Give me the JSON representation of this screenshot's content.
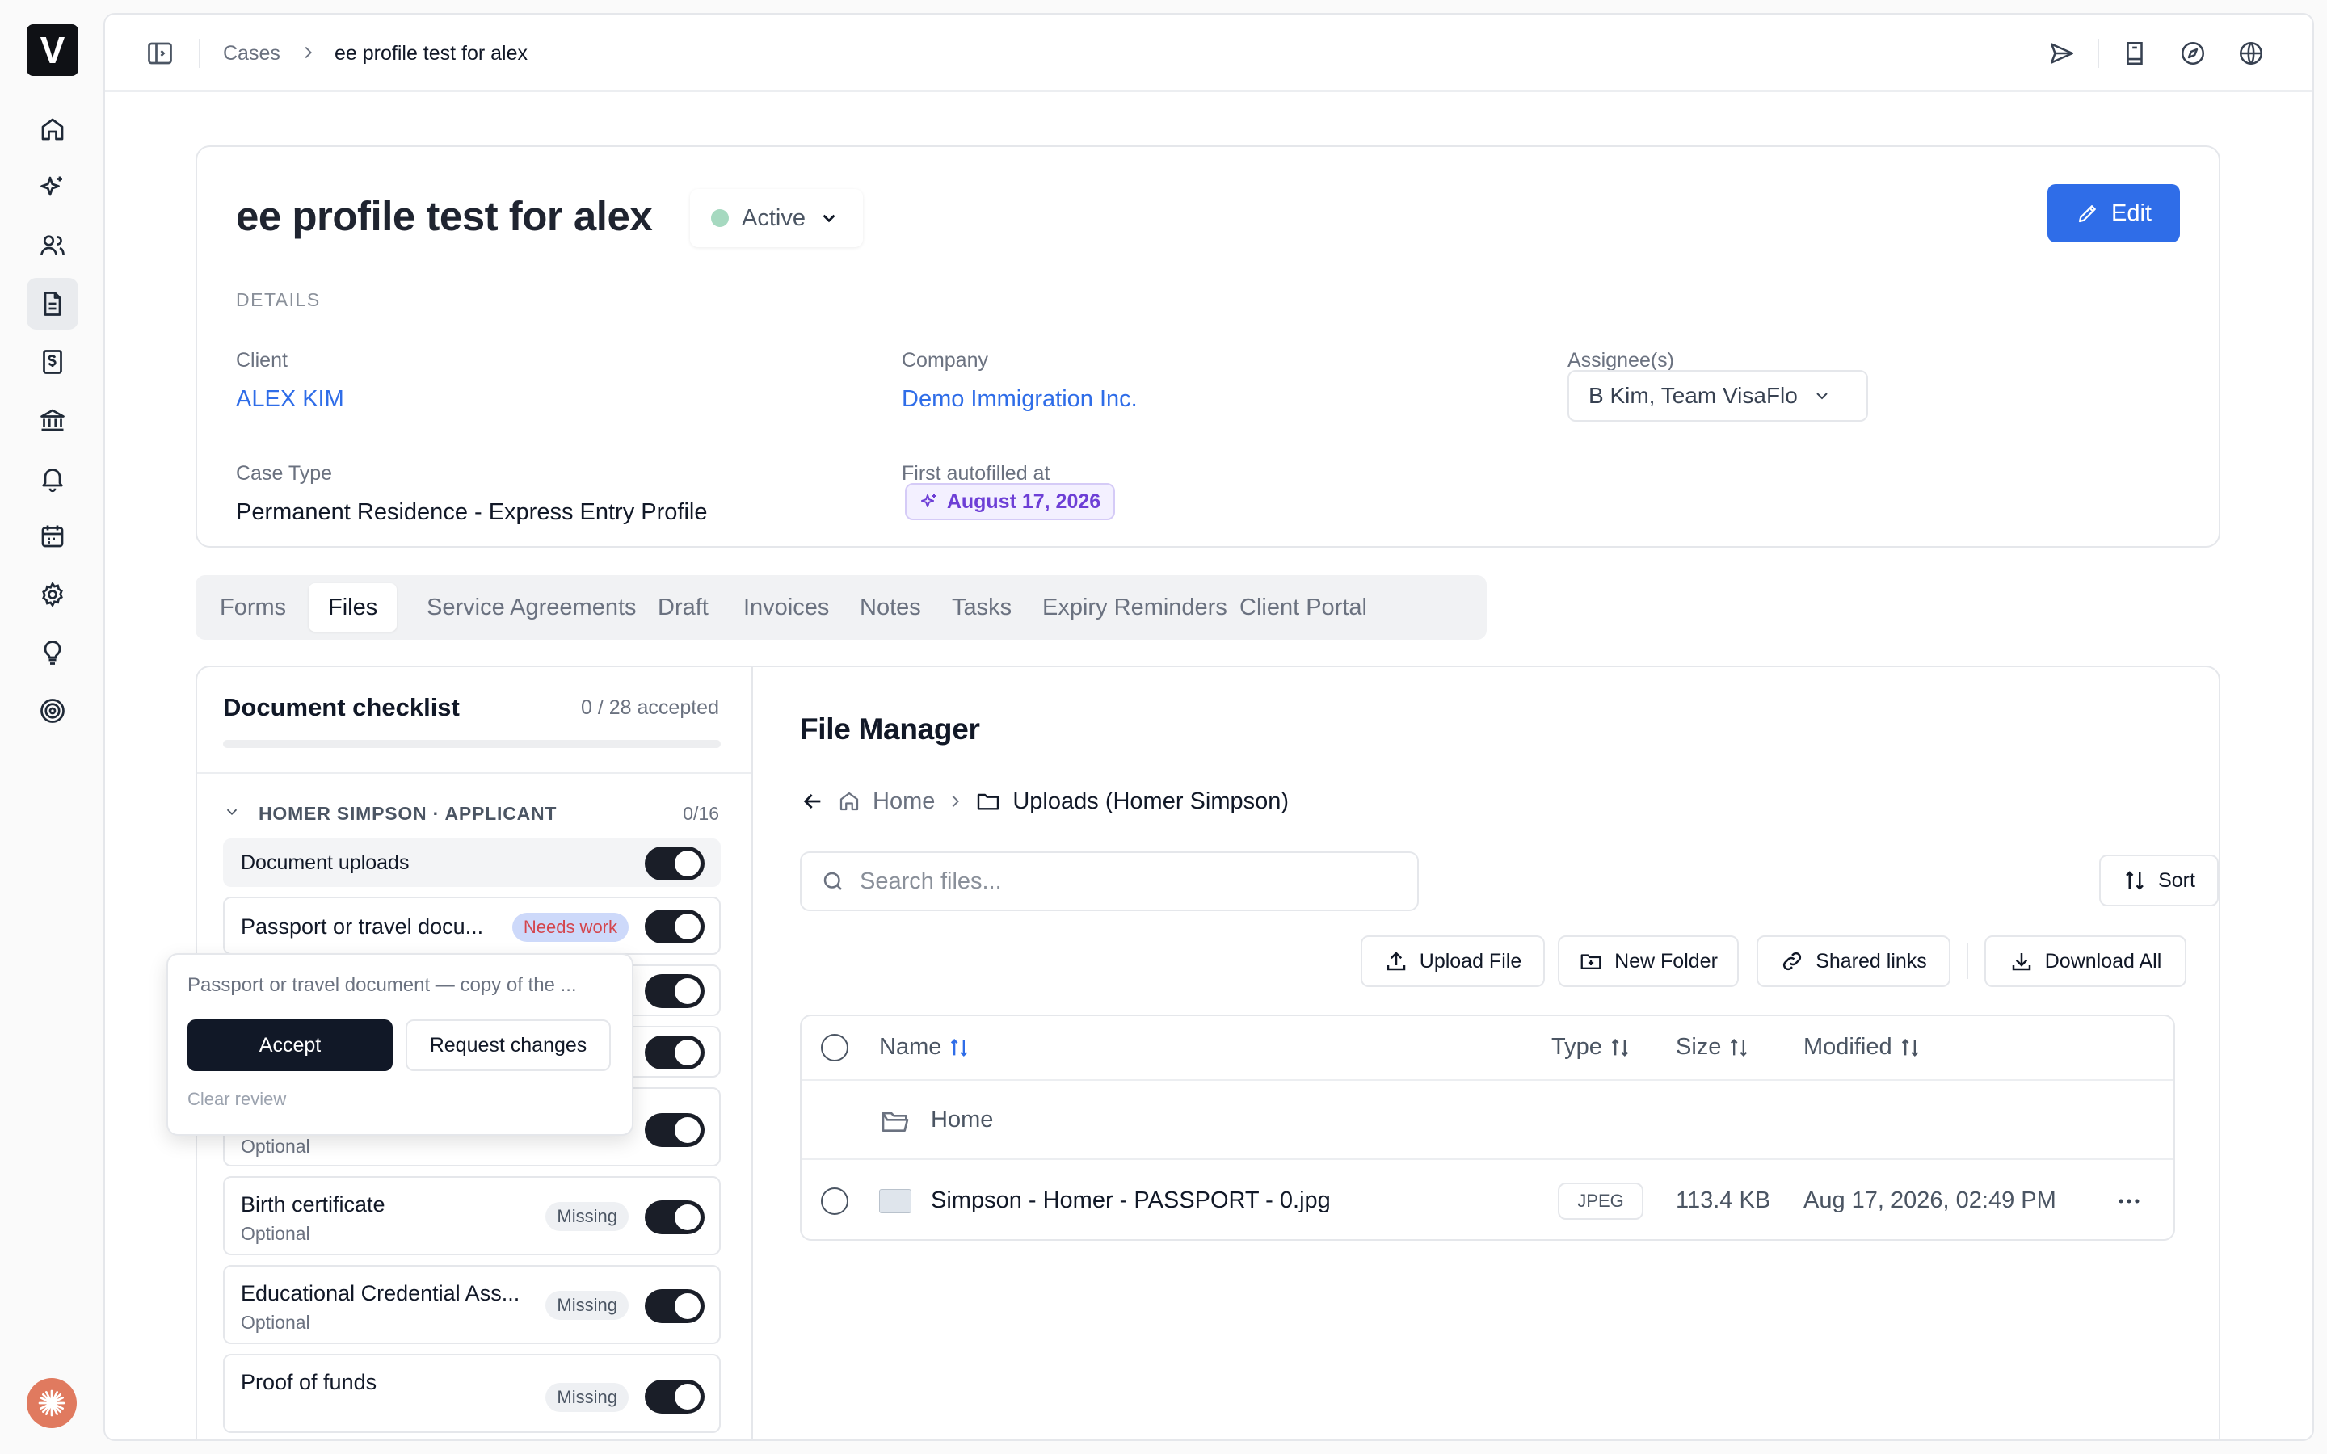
{
  "app": {
    "logo": "V",
    "rail_icons": [
      "home-icon",
      "sparkles-icon",
      "users-icon",
      "document-icon",
      "invoice-icon",
      "bank-icon",
      "bell-icon",
      "calendar-icon",
      "settings-icon",
      "lightbulb-icon",
      "target-icon"
    ],
    "active_rail_index": 3
  },
  "topbar": {
    "breadcrumb": [
      "Cases",
      "ee profile test for alex"
    ],
    "icons": [
      "send-icon",
      "book-icon",
      "compass-icon",
      "globe-icon"
    ]
  },
  "case": {
    "title": "ee profile test for alex",
    "status": "Active",
    "status_color": "#a6d9c0",
    "edit_label": "Edit",
    "section_label": "DETAILS",
    "client_label": "Client",
    "client_value": "ALEX KIM",
    "company_label": "Company",
    "company_value": "Demo Immigration Inc.",
    "assignees_label": "Assignee(s)",
    "assignees_value": "B Kim, Team VisaFlo",
    "case_type_label": "Case Type",
    "case_type_value": "Permanent Residence - Express Entry Profile",
    "autofill_label": "First autofilled at",
    "autofill_value": "August 17, 2026"
  },
  "tabs": [
    "Forms",
    "Files",
    "Service Agreements",
    "Draft",
    "Invoices",
    "Notes",
    "Tasks",
    "Expiry Reminders",
    "Client Portal"
  ],
  "active_tab": "Files",
  "checklist": {
    "title": "Document checklist",
    "accepted": "0 / 28 accepted",
    "accepted_fraction": 0,
    "group": "HOMER SIMPSON · APPLICANT",
    "group_count": "0/16",
    "section_row": "Document uploads",
    "items": [
      {
        "title": "Passport or travel docu...",
        "badge": "Needs work"
      },
      {
        "title": "",
        "sub": "Optional",
        "badge": ""
      },
      {
        "title": "Birth certificate",
        "sub": "Optional",
        "badge": "Missing"
      },
      {
        "title": "Educational Credential Ass...",
        "sub": "Optional",
        "badge": "Missing"
      },
      {
        "title": "Proof of funds",
        "badge": "Missing"
      }
    ],
    "popover": {
      "text": "Passport or travel document — copy of the ...",
      "accept": "Accept",
      "request": "Request changes",
      "clear": "Clear review"
    }
  },
  "file_manager": {
    "title": "File Manager",
    "crumbs": [
      "Home",
      "Uploads (Homer Simpson)"
    ],
    "search_placeholder": "Search files...",
    "sort_label": "Sort",
    "buttons": [
      "Upload File",
      "New Folder",
      "Shared links",
      "Download All"
    ],
    "columns": [
      "Name",
      "Type",
      "Size",
      "Modified"
    ],
    "folder_row": "Home",
    "files": [
      {
        "name": "Simpson - Homer - PASSPORT - 0.jpg",
        "type": "JPEG",
        "size": "113.4 KB",
        "modified": "Aug 17, 2026, 02:49 PM"
      }
    ]
  }
}
